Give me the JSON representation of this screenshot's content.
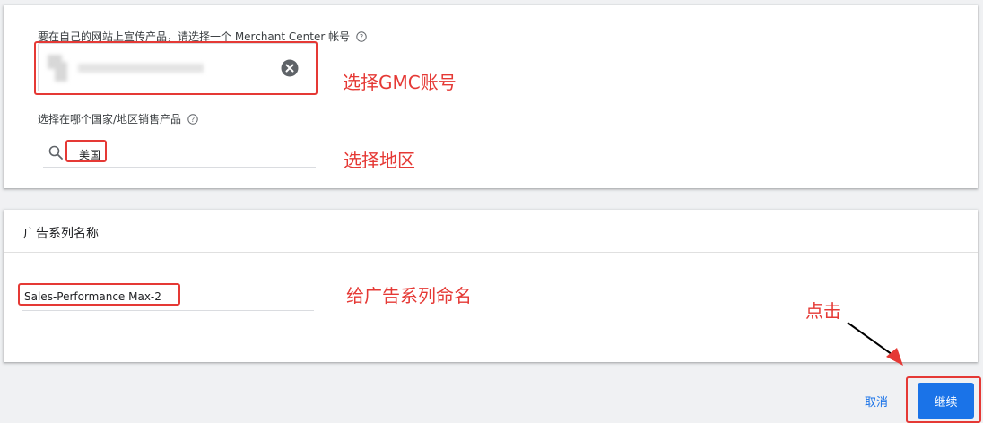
{
  "merchant_section": {
    "account_label": "要在自己的网站上宣传产品，请选择一个 Merchant Center 帐号",
    "country_label": "选择在哪个国家/地区销售产品",
    "country_value": "美国"
  },
  "campaign_section": {
    "title": "广告系列名称",
    "name_value": "Sales-Performance Max-2"
  },
  "annotations": {
    "select_gmc": "选择GMC账号",
    "select_region": "选择地区",
    "name_campaign": "给广告系列命名",
    "click": "点击"
  },
  "footer": {
    "cancel_label": "取消",
    "continue_label": "继续"
  },
  "colors": {
    "accent": "#1a73e8",
    "annotation": "#e53935",
    "background": "#f0f1f3"
  },
  "icons": [
    "help-icon",
    "clear-icon",
    "search-icon",
    "arrow-icon"
  ]
}
